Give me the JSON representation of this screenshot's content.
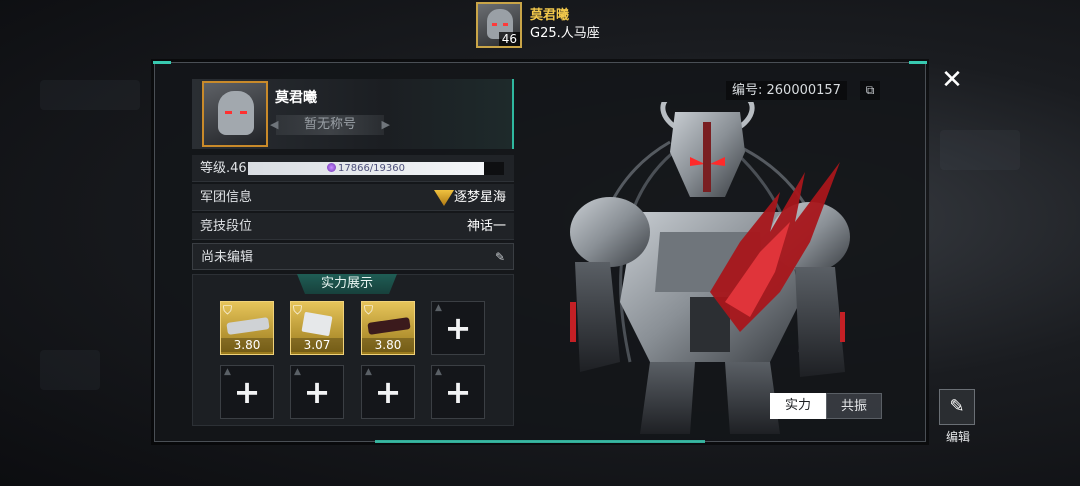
{
  "header": {
    "player_name": "莫君曦",
    "avatar_level": "46",
    "rank": "G25.人马座"
  },
  "profile": {
    "name": "莫君曦",
    "title": "暂无称号",
    "level_label": "等级.46",
    "xp_text": "17866/19360",
    "xp_progress": 0.923,
    "legion_label": "军团信息",
    "legion_value": "逐梦星海",
    "arena_label": "竞技段位",
    "arena_value": "神话一",
    "bio": "尚未编辑"
  },
  "showcase": {
    "title": "实力展示",
    "slots": [
      {
        "score": "3.80",
        "filled": true
      },
      {
        "score": "3.07",
        "filled": true
      },
      {
        "score": "3.80",
        "filled": true
      },
      {
        "score": "",
        "filled": false
      },
      {
        "score": "",
        "filled": false
      },
      {
        "score": "",
        "filled": false
      },
      {
        "score": "",
        "filled": false
      },
      {
        "score": "",
        "filled": false
      }
    ]
  },
  "right": {
    "id_text": "编号: 260000157",
    "tab_strength": "实力",
    "tab_resonance": "共振",
    "edit_label": "编辑"
  },
  "icons": {
    "close": "close-icon",
    "copy": "copy-icon",
    "edit": "pencil-icon",
    "add": "plus-icon"
  },
  "colors": {
    "accent_teal": "#38c9b0",
    "gold": "#f2c84b",
    "slot_gold": "#e6c45a"
  }
}
